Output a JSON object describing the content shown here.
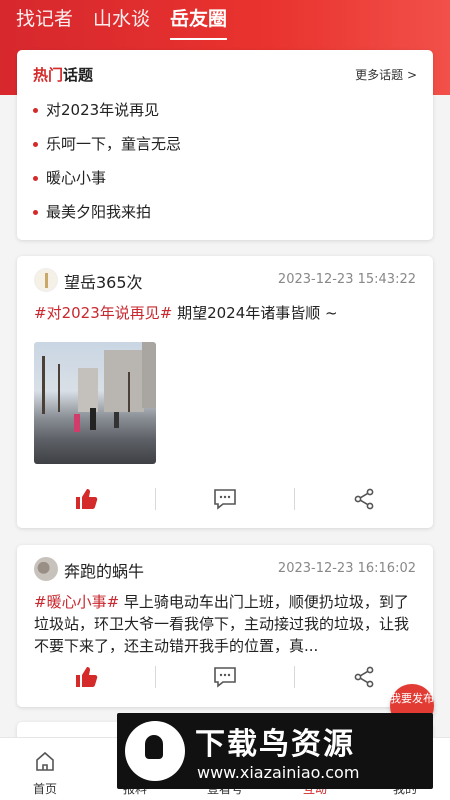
{
  "top_tabs": [
    "找记者",
    "山水谈",
    "岳友圈"
  ],
  "hot": {
    "title_hl": "热门",
    "title_rest": "话题",
    "more": "更多话题 >",
    "items": [
      "对2023年说再见",
      "乐呵一下，童言无忌",
      "暖心小事",
      "最美夕阳我来拍"
    ]
  },
  "posts": [
    {
      "user": "望岳365次",
      "time": "2023-12-23 15:43:22",
      "topic": "#对2023年说再见#",
      "text": "期望2024年诸事皆顺 ~"
    },
    {
      "user": "奔跑的蜗牛",
      "time": "2023-12-23 16:16:02",
      "topic": "#暖心小事#",
      "text": "早上骑电动车出门上班，顺便扔垃圾，到了垃圾站，环卫大爷一看我停下，主动接过我的垃圾，让我不要下来了，还主动错开我手的位置，真..."
    }
  ],
  "fab": "我要发布",
  "bottom_nav": [
    {
      "label": "首页",
      "icon": "home-icon"
    },
    {
      "label": "报料",
      "icon": "report-icon"
    },
    {
      "label": "壹看号",
      "icon": "channel-icon"
    },
    {
      "label": "互动",
      "icon": "interact-icon"
    },
    {
      "label": "我的",
      "icon": "profile-icon"
    }
  ],
  "watermark": {
    "title": "下载鸟资源",
    "url": "www.xiazainiao.com"
  },
  "colors": {
    "brand_red": "#d42a2a",
    "topic_red": "#c8282e",
    "like_red": "#d42a2a"
  }
}
